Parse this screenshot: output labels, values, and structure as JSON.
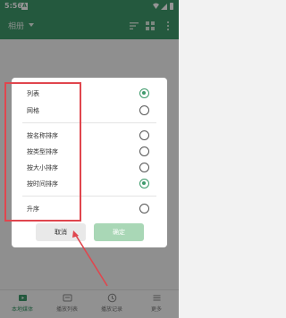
{
  "status_bar": {
    "time": "5:56",
    "notification_icon": "A"
  },
  "app_bar": {
    "title": "相册"
  },
  "dialog": {
    "view_options": [
      {
        "label": "列表",
        "checked": true
      },
      {
        "label": "网格",
        "checked": false
      }
    ],
    "sort_options": [
      {
        "label": "按名称排序",
        "checked": false
      },
      {
        "label": "按类型排序",
        "checked": false
      },
      {
        "label": "按大小排序",
        "checked": false
      },
      {
        "label": "按时间排序",
        "checked": true
      }
    ],
    "order_option": {
      "label": "升序",
      "checked": false
    },
    "cancel_label": "取消",
    "confirm_label": "确定"
  },
  "bottom_nav": [
    {
      "label": "本地媒体"
    },
    {
      "label": "播放列表"
    },
    {
      "label": "播放记录"
    },
    {
      "label": "更多"
    }
  ],
  "colors": {
    "brand": "#3e9a6b",
    "annotation": "#e0464e",
    "confirm_disabled": "#a9d7b6"
  },
  "icons": [
    "wifi-icon",
    "signal-icon",
    "battery-icon",
    "sort-icon",
    "grid-icon",
    "more-vert-icon",
    "local-media-icon",
    "playlist-icon",
    "history-icon",
    "menu-icon"
  ]
}
